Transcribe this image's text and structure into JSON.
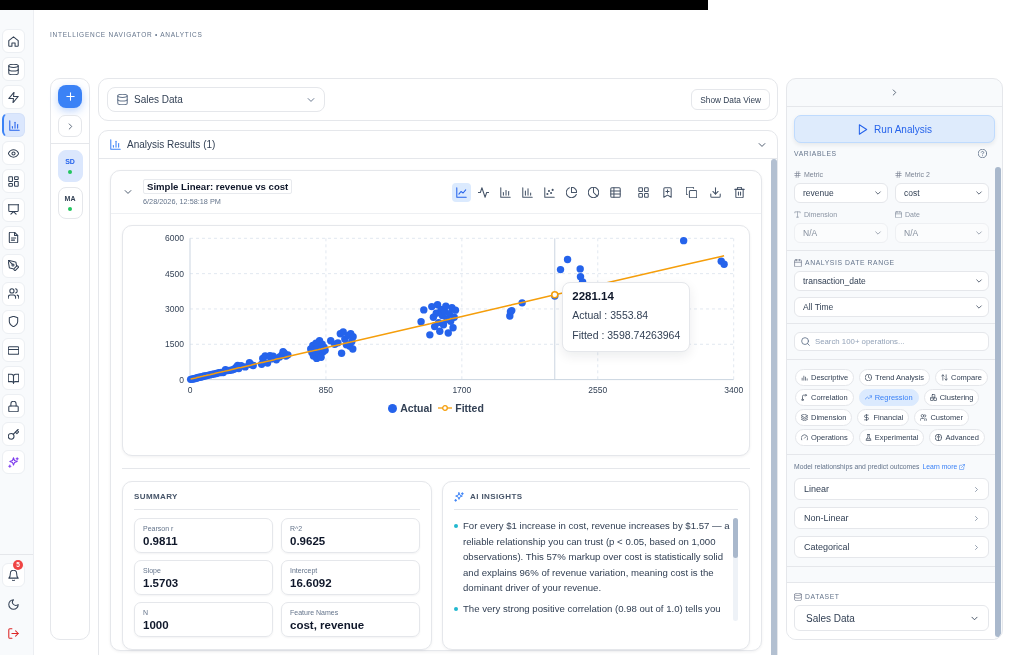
{
  "nav_rail": {
    "items": [
      {
        "kind": "home",
        "selected": false
      },
      {
        "kind": "database",
        "selected": false
      },
      {
        "kind": "bolt",
        "selected": false
      },
      {
        "kind": "bar-chart",
        "selected": true
      },
      {
        "kind": "eye",
        "selected": false
      },
      {
        "kind": "dashboard",
        "selected": false
      },
      {
        "kind": "presentation",
        "selected": false
      },
      {
        "kind": "file",
        "selected": false
      },
      {
        "kind": "pen",
        "selected": false
      },
      {
        "kind": "users",
        "selected": false
      },
      {
        "kind": "shield",
        "selected": false
      },
      {
        "kind": "card",
        "selected": false
      },
      {
        "kind": "book",
        "selected": false
      },
      {
        "kind": "lock",
        "selected": false
      },
      {
        "kind": "key",
        "selected": false
      },
      {
        "kind": "sparkles",
        "selected": false
      }
    ],
    "bottom_items": [
      {
        "kind": "bell",
        "badge": "5"
      },
      {
        "kind": "moon"
      },
      {
        "kind": "logout"
      }
    ]
  },
  "breadcrumb": "INTELLIGENCE NAVIGATOR • ANALYTICS",
  "session_rail": {
    "sessions": [
      {
        "initials": "SD",
        "selected": true,
        "online": true
      },
      {
        "initials": "MA",
        "selected": false,
        "online": true
      }
    ]
  },
  "dataset_bar": {
    "dataset": "Sales Data",
    "view_button": "Show Data View"
  },
  "results": {
    "title": "Analysis Results (1)",
    "expanded": true,
    "card": {
      "title": "Simple Linear: revenue vs cost",
      "timestamp": "6/28/2026, 12:58:18 PM",
      "expanded": true,
      "view_tools": [
        {
          "kind": "line",
          "selected": true
        },
        {
          "kind": "pulse",
          "selected": false
        },
        {
          "kind": "bar",
          "selected": false
        },
        {
          "kind": "column",
          "selected": false
        },
        {
          "kind": "scatter",
          "selected": false
        },
        {
          "kind": "pie",
          "selected": false
        },
        {
          "kind": "donut",
          "selected": false
        },
        {
          "kind": "table",
          "selected": false
        }
      ],
      "action_tools": [
        {
          "kind": "grid"
        },
        {
          "kind": "bookmark"
        },
        {
          "kind": "copy"
        },
        {
          "kind": "download"
        },
        {
          "kind": "trash"
        }
      ],
      "chart": {
        "chart_data": {
          "type": "scatter",
          "grid": true,
          "legend": "bottom",
          "xlim": [
            0,
            3400
          ],
          "ylim": [
            0,
            6000
          ],
          "xticks": [
            0,
            850,
            1700,
            2550,
            3400
          ],
          "yticks": [
            0,
            1500,
            3000,
            4500,
            6000
          ],
          "x": [
            4,
            12,
            20,
            28,
            36,
            44,
            52,
            60,
            70,
            80,
            90,
            100,
            112,
            124,
            136,
            150,
            165,
            180,
            195,
            208,
            222,
            230,
            245,
            262,
            275,
            288,
            298,
            305,
            320,
            345,
            372,
            380,
            395,
            448,
            455,
            470,
            485,
            500,
            508,
            520,
            540,
            560,
            575,
            582,
            590,
            600,
            612,
            755,
            762,
            768,
            772,
            784,
            788,
            792,
            800,
            805,
            810,
            820,
            826,
            832,
            838,
            845,
            880,
            905,
            925,
            940,
            948,
            958,
            968,
            978,
            990,
            1000,
            1005,
            1012,
            1018,
            1020,
            1445,
            1462,
            1500,
            1512,
            1522,
            1530,
            1540,
            1548,
            1555,
            1562,
            1570,
            1578,
            1585,
            1592,
            1600,
            1608,
            1615,
            1622,
            1630,
            1638,
            1645,
            1652,
            1660,
            2000,
            2004,
            2012,
            2077,
            2281.14,
            2317,
            2361,
            2440,
            2442,
            2455,
            3087,
            3322,
            3340
          ],
          "series": [
            {
              "name": "Actual",
              "color": "#2563eb",
              "values": [
                10,
                20,
                30,
                40,
                60,
                70,
                90,
                100,
                110,
                130,
                150,
                160,
                180,
                200,
                220,
                240,
                260,
                290,
                300,
                300,
                420,
                380,
                390,
                410,
                440,
                520,
                600,
                470,
                590,
                540,
                720,
                640,
                600,
                650,
                900,
                1000,
                700,
                1020,
                880,
                990,
                840,
                960,
                1050,
                1180,
                1120,
                1000,
                1050,
                1300,
                1150,
                1450,
                1000,
                1250,
                1550,
                900,
                1420,
                1100,
                1650,
                950,
                1500,
                1180,
                1380,
                1250,
                1650,
                1500,
                1560,
                1950,
                1120,
                2020,
                1720,
                1480,
                1880,
                1420,
                1950,
                1620,
                1300,
                1820,
                2460,
                2960,
                1900,
                3100,
                2650,
                2250,
                2820,
                3180,
                2420,
                2050,
                2980,
                2720,
                2330,
                2900,
                3120,
                2560,
                1980,
                2800,
                2480,
                3050,
                2200,
                2650,
                2950,
                2700,
                2880,
                2930,
                3260,
                3550,
                4670,
                5100,
                4700,
                4370,
                4150,
                5900,
                5030,
                4900
              ]
            },
            {
              "name": "Fitted",
              "type": "line",
              "color": "#f59e0b",
              "values": [
                20,
                40,
                50,
                60,
                70,
                90,
                100,
                110,
                130,
                140,
                160,
                170,
                190,
                210,
                230,
                250,
                280,
                300,
                320,
                340,
                370,
                380,
                400,
                430,
                450,
                470,
                490,
                500,
                520,
                560,
                600,
                610,
                640,
                720,
                730,
                760,
                780,
                800,
                810,
                830,
                870,
                900,
                920,
                930,
                940,
                960,
                980,
                1200,
                1210,
                1220,
                1230,
                1250,
                1250,
                1260,
                1270,
                1280,
                1290,
                1300,
                1310,
                1320,
                1330,
                1340,
                1400,
                1440,
                1470,
                1490,
                1510,
                1520,
                1540,
                1550,
                1570,
                1590,
                1600,
                1610,
                1620,
                1620,
                2290,
                2310,
                2370,
                2390,
                2410,
                2420,
                2440,
                2450,
                2460,
                2470,
                2480,
                2500,
                2510,
                2520,
                2530,
                2540,
                2550,
                2560,
                2580,
                2590,
                2600,
                2610,
                2620,
                3160,
                3160,
                3180,
                3280,
                3600,
                3660,
                null,
                null,
                null,
                null,
                4860,
                5230,
                5260
              ]
            }
          ],
          "ref_lines": [
            {
              "axis": "x",
              "value": 2281.14
            }
          ],
          "annotations": [
            {
              "x": 2281.14,
              "text": "2281.14"
            }
          ]
        },
        "tooltip": {
          "rows": [
            "Actual : 3553.84",
            "Fitted : 3598.74263964"
          ]
        }
      },
      "summary": {
        "title": "SUMMARY",
        "stats": [
          {
            "label": "Pearson r",
            "value": "0.9811"
          },
          {
            "label": "R^2",
            "value": "0.9625"
          },
          {
            "label": "Slope",
            "value": "1.5703"
          },
          {
            "label": "Intercept",
            "value": "16.6092"
          },
          {
            "label": "N",
            "value": "1000"
          },
          {
            "label": "Feature Names",
            "value": "cost, revenue"
          }
        ]
      },
      "insights": {
        "title": "AI INSIGHTS",
        "bullets": [
          "For every $1 increase in cost, revenue increases by $1.57 — a reliable relationship you can trust (p < 0.05, based on 1,000 observations). This 57% markup over cost is statistically solid and explains 96% of revenue variation, meaning cost is the dominant driver of your revenue.",
          "The very strong positive correlation (0.98 out of 1.0) tells you"
        ]
      }
    }
  },
  "side_panel": {
    "run_button": "Run Analysis",
    "variables": {
      "title": "VARIABLES",
      "fields": [
        {
          "kind": "number",
          "label": "Metric",
          "value": "revenue",
          "disabled": false
        },
        {
          "kind": "number",
          "label": "Metric 2",
          "value": "cost",
          "disabled": false
        },
        {
          "kind": "text",
          "label": "Dimension",
          "value": "N/A",
          "disabled": true
        },
        {
          "kind": "date",
          "label": "Date",
          "value": "N/A",
          "disabled": true
        }
      ]
    },
    "date_range": {
      "title": "ANALYSIS DATE RANGE",
      "date_field": "transaction_date",
      "period": "All Time"
    },
    "search": {
      "placeholder": "Search 100+ operations..."
    },
    "categories": [
      {
        "kind": "descriptive",
        "label": "Descriptive",
        "selected": false
      },
      {
        "kind": "trend",
        "label": "Trend Analysis",
        "selected": false
      },
      {
        "kind": "compare",
        "label": "Compare",
        "selected": false
      },
      {
        "kind": "correlation",
        "label": "Correlation",
        "selected": false
      },
      {
        "kind": "regression",
        "label": "Regression",
        "selected": true
      },
      {
        "kind": "clustering",
        "label": "Clustering",
        "selected": false
      },
      {
        "kind": "dimension",
        "label": "Dimension",
        "selected": false
      },
      {
        "kind": "financial",
        "label": "Financial",
        "selected": false
      },
      {
        "kind": "customer",
        "label": "Customer",
        "selected": false
      },
      {
        "kind": "operations",
        "label": "Operations",
        "selected": false
      },
      {
        "kind": "experimental",
        "label": "Experimental",
        "selected": false
      },
      {
        "kind": "advanced",
        "label": "Advanced",
        "selected": false
      }
    ],
    "description": "Model relationships and predict outcomes",
    "learn_more": "Learn more",
    "operations": [
      "Linear",
      "Non-Linear",
      "Categorical"
    ],
    "dataset": {
      "title": "DATASET",
      "value": "Sales Data"
    }
  }
}
